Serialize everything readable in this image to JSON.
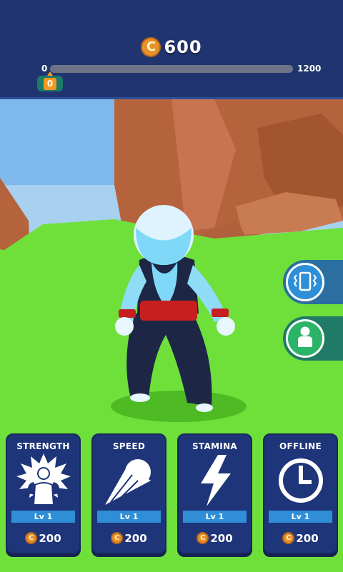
{
  "hud": {
    "coins": "600",
    "progress": {
      "min_label": "0",
      "max_label": "1200",
      "current_label": "0",
      "fill_fraction": 0.0
    }
  },
  "side_buttons": [
    {
      "name": "vibration",
      "icon": "vibration-phone-icon"
    },
    {
      "name": "costume",
      "icon": "character-icon"
    }
  ],
  "upgrades": [
    {
      "title": "STRENGTH",
      "level": "Lv 1",
      "cost": "200",
      "icon": "muscle-power-icon"
    },
    {
      "title": "SPEED",
      "level": "Lv 1",
      "cost": "200",
      "icon": "comet-icon"
    },
    {
      "title": "STAMINA",
      "level": "Lv 1",
      "cost": "200",
      "icon": "lightning-bolt-icon"
    },
    {
      "title": "OFFLINE",
      "level": "Lv 1",
      "cost": "200",
      "icon": "clock-icon"
    }
  ],
  "colors": {
    "hud_bg": "#20356f",
    "coin": "#e8902a",
    "card_bg": "#1f357a",
    "level_bar": "#2f8ed6",
    "grass": "#6fe03a",
    "sky": "#7fb8ea"
  }
}
